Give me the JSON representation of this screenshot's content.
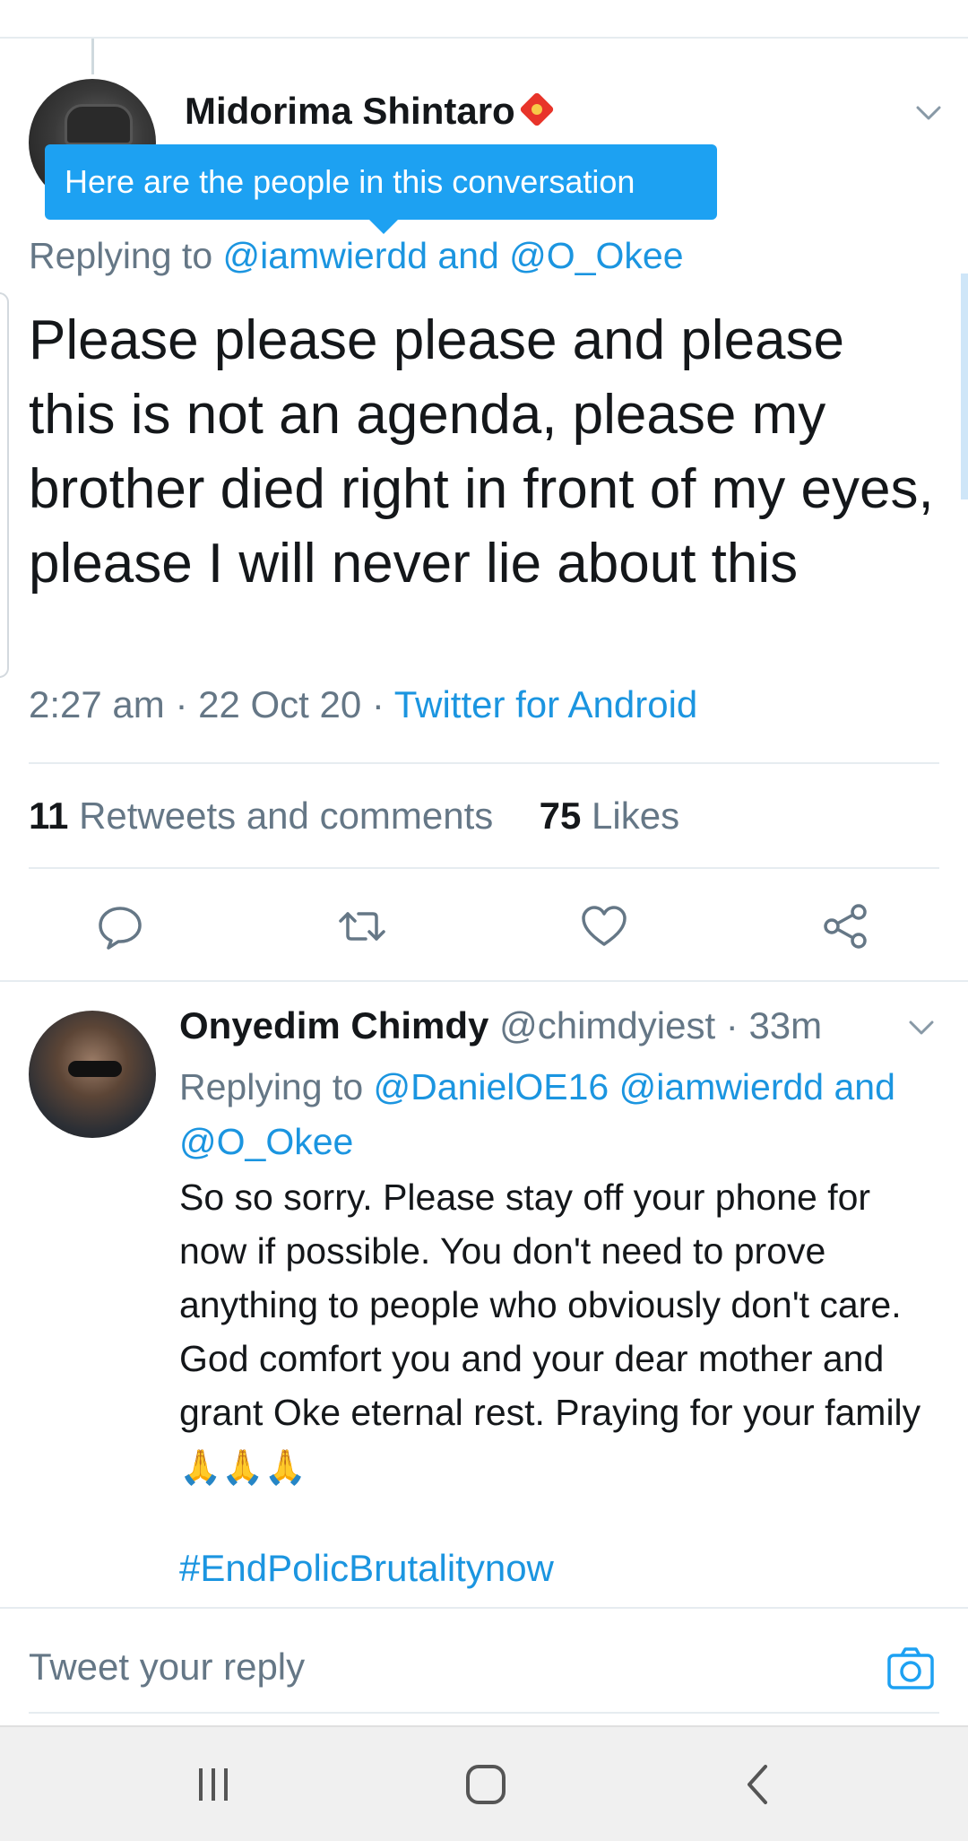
{
  "tweet": {
    "author_name": "Midorima Shintaro",
    "tooltip": "Here are the people in this conversation",
    "replying_prefix": "Replying to",
    "replying_mentions": "@iamwierdd and @O_Okee",
    "text": "Please please please and please this is not an agenda, please my brother died right in front of my eyes, please I will never lie about this",
    "time": "2:27 am",
    "date": "22 Oct 20",
    "source": "Twitter for Android",
    "retweets_count": "11",
    "retweets_label": "Retweets and comments",
    "likes_count": "75",
    "likes_label": "Likes"
  },
  "reply": {
    "name": "Onyedim Chimdy",
    "handle": "@chimdyiest",
    "age": "33m",
    "replying_prefix": "Replying to",
    "replying_mentions": "@DanielOE16 @iamwierdd and @O_Okee",
    "text": "So so sorry. Please stay off your phone for now if possible. You don't need to prove anything to people who obviously don't care. God comfort you and your dear mother and grant Oke eternal rest. Praying for your family",
    "emoji": "🙏🙏🙏",
    "hashtag": "#EndPolicBrutalitynow"
  },
  "composer": {
    "placeholder": "Tweet your reply"
  },
  "icons": {
    "reply": "comment-icon",
    "retweet": "retweet-icon",
    "like": "heart-icon",
    "share": "share-icon",
    "camera": "camera-icon",
    "nav_recent": "recent-apps-icon",
    "nav_home": "home-icon",
    "nav_back": "back-icon"
  },
  "colors": {
    "accent": "#1da1f2",
    "link": "#1b95e0",
    "muted": "#657786",
    "text": "#14171a"
  }
}
